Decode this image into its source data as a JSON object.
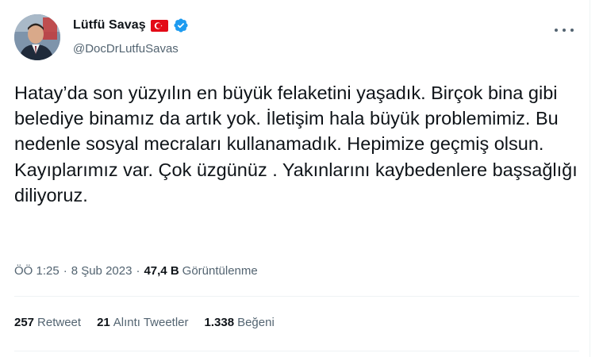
{
  "author": {
    "display_name": "Lütfü Savaş",
    "handle": "@DocDrLutfuSavas",
    "flag_icon": "turkey-flag-icon",
    "verified_icon": "verified-badge-icon",
    "verified_color": "#1d9bf0"
  },
  "tweet": {
    "text": "Hatay’da son yüzyılın en büyük felaketini yaşadık. Birçok bina gibi belediye binamız da artık yok. İletişim hala büyük problemimiz. Bu nedenle sosyal mecraları kullanamadık. Hepimize geçmiş olsun. Kayıplarımız var. Çok üzgünüz . Yakınlarını kaybedenlere başsağlığı diliyoruz."
  },
  "meta": {
    "time": "ÖÖ 1:25",
    "separator": "·",
    "date": "8 Şub 2023",
    "views_count": "47,4 B",
    "views_label": "Görüntülenme"
  },
  "stats": {
    "retweets_count": "257",
    "retweets_label": "Retweet",
    "quotes_count": "21",
    "quotes_label": "Alıntı Tweetler",
    "likes_count": "1.338",
    "likes_label": "Beğeni"
  },
  "more_icon": "more-horizontal-icon"
}
